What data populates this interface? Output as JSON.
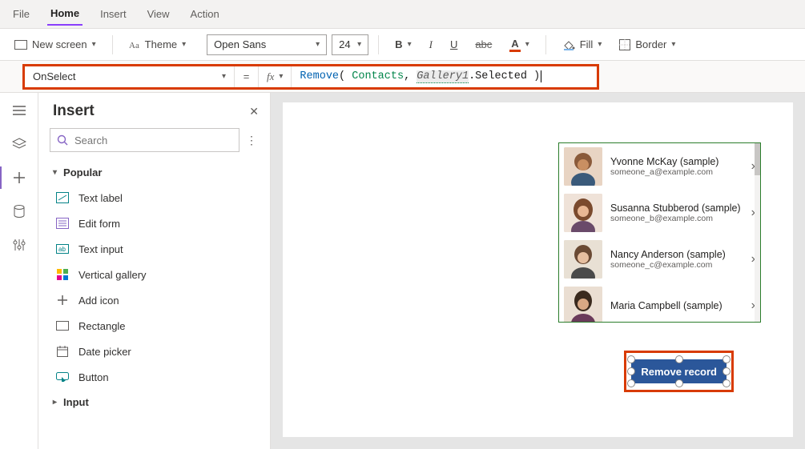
{
  "menu": {
    "file": "File",
    "home": "Home",
    "insert": "Insert",
    "view": "View",
    "action": "Action"
  },
  "ribbon": {
    "new_screen": "New screen",
    "theme": "Theme",
    "font": "Open Sans",
    "font_size": "24",
    "fill": "Fill",
    "border": "Border"
  },
  "formula_bar": {
    "property": "OnSelect",
    "fx_label": "fx",
    "fn": "Remove",
    "paren_open": "(",
    "space": " ",
    "ds": "Contacts",
    "comma": ", ",
    "ctrl": "Gallery1",
    "dot_prop": ".Selected ",
    "paren_close": ")"
  },
  "panel": {
    "title": "Insert",
    "search_placeholder": "Search",
    "group_popular": "Popular",
    "items": {
      "textlabel": "Text label",
      "editform": "Edit form",
      "textinput": "Text input",
      "vgallery": "Vertical gallery",
      "addicon": "Add icon",
      "rectangle": "Rectangle",
      "datepicker": "Date picker",
      "button": "Button"
    },
    "group_input": "Input"
  },
  "gallery": [
    {
      "name": "Yvonne McKay (sample)",
      "email": "someone_a@example.com"
    },
    {
      "name": "Susanna Stubberod (sample)",
      "email": "someone_b@example.com"
    },
    {
      "name": "Nancy Anderson (sample)",
      "email": "someone_c@example.com"
    },
    {
      "name": "Maria Campbell (sample)",
      "email": ""
    }
  ],
  "button_label": "Remove record"
}
